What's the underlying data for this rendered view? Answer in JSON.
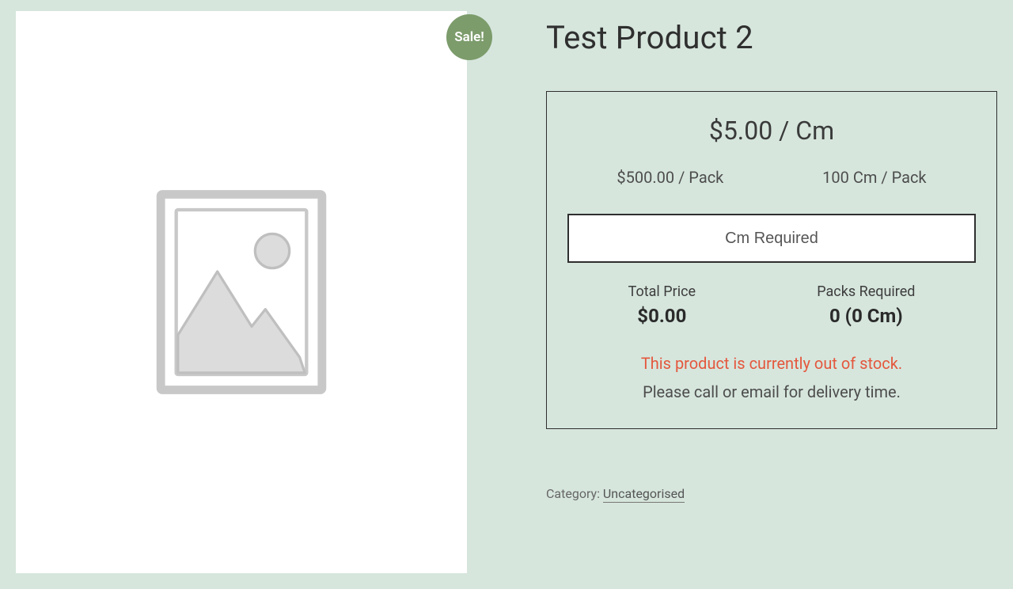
{
  "sale_badge": "Sale!",
  "product": {
    "title": "Test Product 2",
    "unit_price": "$5.00 / Cm",
    "pack_price": "$500.00 / Pack",
    "pack_size": "100 Cm / Pack",
    "qty_placeholder": "Cm Required",
    "totals": {
      "price_label": "Total Price",
      "price_value": "$0.00",
      "packs_label": "Packs Required",
      "packs_value": "0 (0 Cm)"
    },
    "stock_message": "This product is currently out of stock.",
    "delivery_message": "Please call or email for delivery time."
  },
  "category": {
    "label": "Category: ",
    "link_text": "Uncategorised"
  },
  "icons": {
    "placeholder": "image-placeholder-icon"
  }
}
